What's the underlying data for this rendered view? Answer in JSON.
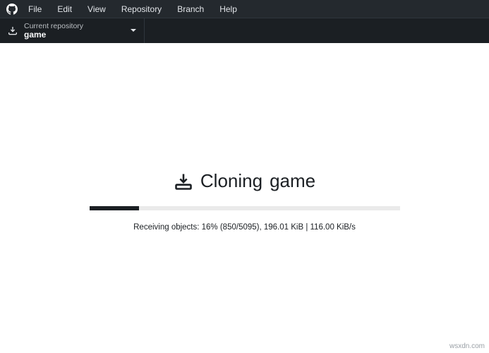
{
  "menu": {
    "items": [
      "File",
      "Edit",
      "View",
      "Repository",
      "Branch",
      "Help"
    ]
  },
  "toolbar": {
    "current_repo_label": "Current repository",
    "current_repo_name": "game"
  },
  "main": {
    "title_prefix": "Cloning",
    "title_repo": "game",
    "progress_percent": 16,
    "status_text": "Receiving objects: 16% (850/5095), 196.01 KiB | 116.00 KiB/s"
  },
  "footer": {
    "watermark": "wsxdn.com"
  }
}
